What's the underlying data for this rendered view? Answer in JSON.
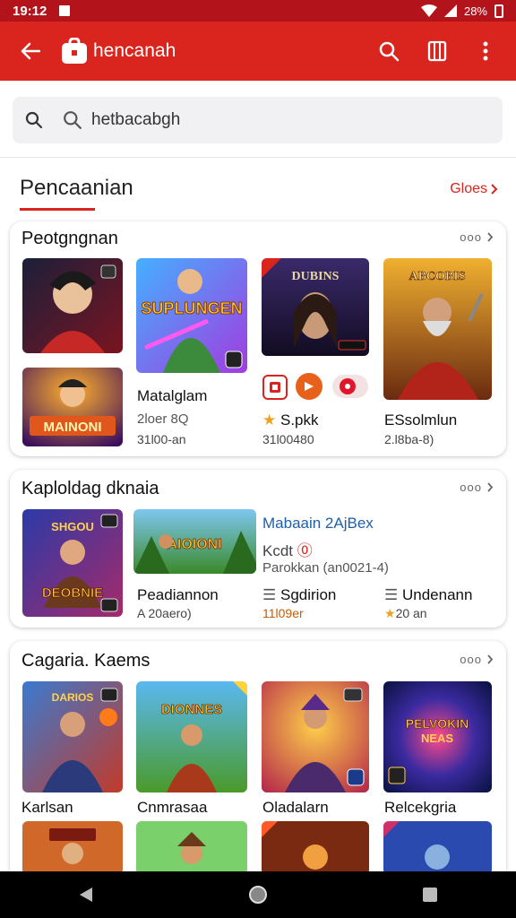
{
  "status": {
    "time": "19:12",
    "battery": "28%"
  },
  "appbar": {
    "title": "hencanah",
    "back_icon": "arrow-left-icon",
    "search_icon": "search-icon",
    "bookmark_icon": "book-icon",
    "menu_icon": "more-vert-icon"
  },
  "search": {
    "value": "hetbacabgh"
  },
  "main": {
    "title": "Pencaanian",
    "more": "Gloes"
  },
  "sections": [
    {
      "title": "Peotgngnan",
      "more": "ooo",
      "items": [
        {
          "label": "Matalglam",
          "sub": "2loer 8Q",
          "sub2": "31l00-an"
        },
        {
          "label": "S.pkk",
          "sub": "31l00480"
        },
        {
          "label": "ESsolmlun",
          "sub": "2.l8ba-8)"
        }
      ]
    },
    {
      "title": "Kaploldag dknaia",
      "more": "ooo",
      "feature": {
        "title": "Mabaain 2AjBex",
        "line2": "Kcdt",
        "line3": "Parokkan (an0021-4)"
      },
      "items": [
        {
          "label": "Peadiannon",
          "sub": "A 20aero)"
        },
        {
          "label": "Sgdirion",
          "sub": "11l09er"
        },
        {
          "label": "Undenann",
          "sub": "20 an"
        }
      ]
    },
    {
      "title": "Cagaria. Kaems",
      "more": "ooo",
      "items": [
        {
          "label": "Karlsan"
        },
        {
          "label": "Cnmrasaa"
        },
        {
          "label": "Oladalarn"
        },
        {
          "label": "Relcekgria"
        }
      ]
    }
  ]
}
